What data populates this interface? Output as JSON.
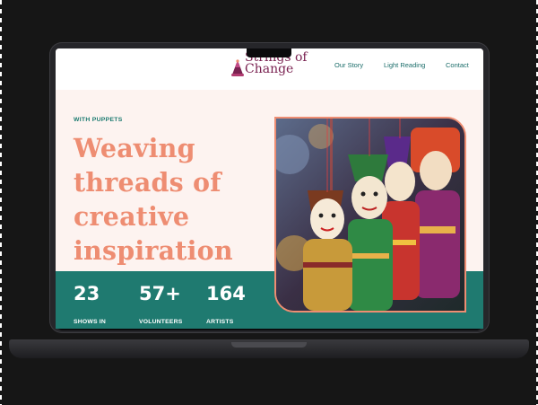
{
  "brand": {
    "name": "Strings of Change",
    "line1": "Strings of",
    "line2": "Change",
    "color": "#7a2251"
  },
  "nav": {
    "items": [
      "Our Story",
      "Light Reading",
      "Contact"
    ]
  },
  "hero": {
    "eyebrow": "WITH PUPPETS",
    "title_lines": [
      "Weaving",
      "threads of",
      "creative",
      "inspiration"
    ],
    "image": "puppets-photo"
  },
  "stats": [
    {
      "value": "23",
      "label": "SHOWS IN"
    },
    {
      "value": "57+",
      "label": "VOLUNTEERS"
    },
    {
      "value": "164",
      "label": "ARTISTS"
    }
  ],
  "colors": {
    "accent": "#ee8d72",
    "teal": "#1f7a70",
    "page_bg": "#fdf3f0",
    "nav_text": "#1b6d6a",
    "laptop": "#26262a",
    "background": "#161616"
  },
  "icons": [
    "party-hat-logo-icon"
  ]
}
